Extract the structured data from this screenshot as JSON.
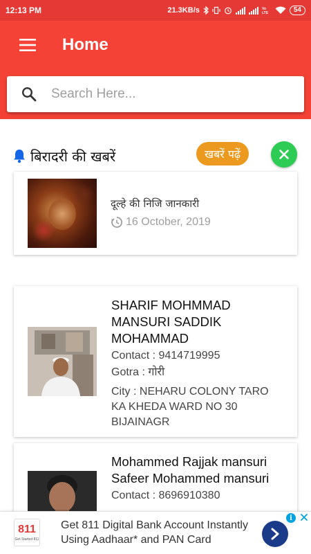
{
  "status_bar": {
    "time": "12:13 PM",
    "network_speed": "21.3KB/s",
    "battery": "54",
    "icons": [
      "bluetooth-icon",
      "vibrate-icon",
      "alarm-icon",
      "signal-icon",
      "signal-icon",
      "volte-icon",
      "wifi-icon",
      "battery-icon"
    ]
  },
  "app_bar": {
    "title": "Home",
    "menu_icon": "hamburger-menu-icon"
  },
  "search": {
    "placeholder": "Search Here...",
    "value": "",
    "icon": "search-icon"
  },
  "news_section": {
    "title": "बिरादरी की खबरें",
    "icon": "bell-icon",
    "read_button": "खबरें पढ़ें",
    "close_icon": "close-icon",
    "accent_color": "#ec9a1f",
    "close_color": "#2ecc55",
    "items": [
      {
        "title": "दूल्हे की निजि जानकारी",
        "date": "16 October, 2019"
      }
    ]
  },
  "profiles": [
    {
      "name": "SHARIF MOHMMAD MANSURI SADDIK MOHAMMAD",
      "contact": "Contact : 9414719995",
      "gotra": "Gotra : गोरी",
      "city": "City : NEHARU COLONY TARO KA KHEDA WARD NO 30 BIJAINAGR"
    },
    {
      "name": "Mohammed Rajjak mansuri Safeer Mohammed mansuri",
      "contact": "Contact : 8696910380"
    }
  ],
  "ad": {
    "logo_text": "811",
    "logo_sub": "Get Started 811",
    "text": "Get 811 Digital Bank Account Instantly Using Aadhaar* and PAN Card",
    "info_icon": "info-icon",
    "close_icon": "ad-close-icon",
    "go_icon": "chevron-right-icon"
  },
  "colors": {
    "status_bar": "#e53935",
    "app_bar": "#f44336"
  }
}
